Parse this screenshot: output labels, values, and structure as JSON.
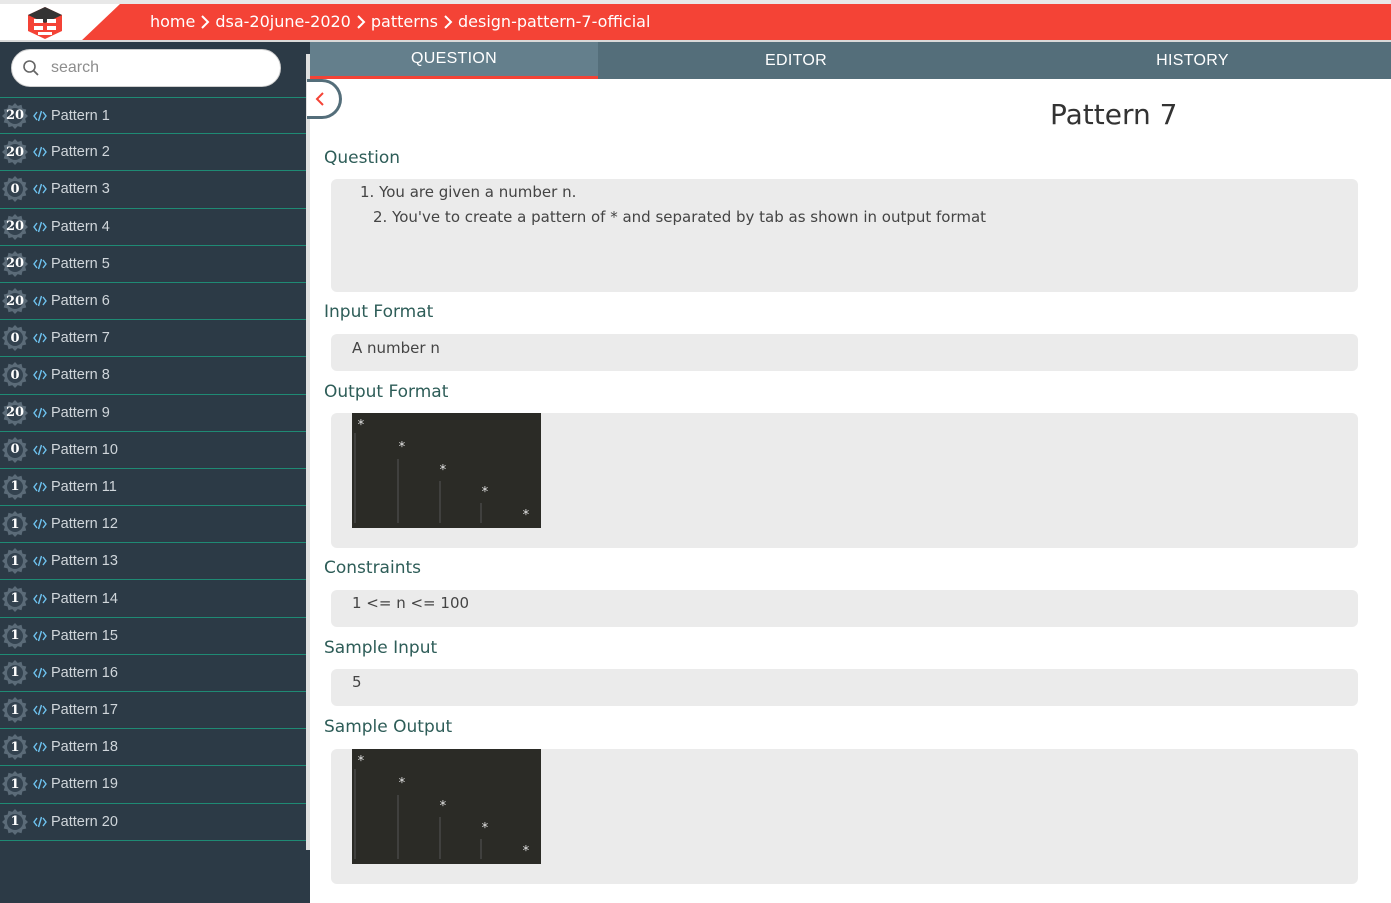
{
  "header": {
    "logo_icon": "pepcoding-logo-icon",
    "breadcrumb": [
      "home",
      "dsa-20june-2020",
      "patterns",
      "design-pattern-7-official"
    ]
  },
  "sidebar": {
    "search": {
      "placeholder": "search",
      "value": ""
    },
    "items": [
      {
        "score": "20",
        "label": "Pattern 1"
      },
      {
        "score": "20",
        "label": "Pattern 2"
      },
      {
        "score": "0",
        "label": "Pattern 3"
      },
      {
        "score": "20",
        "label": "Pattern 4"
      },
      {
        "score": "20",
        "label": "Pattern 5"
      },
      {
        "score": "20",
        "label": "Pattern 6"
      },
      {
        "score": "0",
        "label": "Pattern 7"
      },
      {
        "score": "0",
        "label": "Pattern 8"
      },
      {
        "score": "20",
        "label": "Pattern 9"
      },
      {
        "score": "0",
        "label": "Pattern 10"
      },
      {
        "score": "1",
        "label": "Pattern 11"
      },
      {
        "score": "1",
        "label": "Pattern 12"
      },
      {
        "score": "1",
        "label": "Pattern 13"
      },
      {
        "score": "1",
        "label": "Pattern 14"
      },
      {
        "score": "1",
        "label": "Pattern 15"
      },
      {
        "score": "1",
        "label": "Pattern 16"
      },
      {
        "score": "1",
        "label": "Pattern 17"
      },
      {
        "score": "1",
        "label": "Pattern 18"
      },
      {
        "score": "1",
        "label": "Pattern 19"
      },
      {
        "score": "1",
        "label": "Pattern 20"
      }
    ]
  },
  "tabs": [
    {
      "label": "QUESTION",
      "active": true
    },
    {
      "label": "EDITOR",
      "active": false
    },
    {
      "label": "HISTORY",
      "active": false
    }
  ],
  "main": {
    "title": "Pattern 7",
    "question_label": "Question",
    "question_lines": [
      "1. You are given a number n.",
      "2. You've to create a pattern of * and separated by tab as shown in output format"
    ],
    "input_format_label": "Input Format",
    "input_format": "A number n",
    "output_format_label": "Output Format",
    "constraints_label": "Constraints",
    "constraints": "1 <= n <= 100",
    "sample_input_label": "Sample Input",
    "sample_input": "5",
    "sample_output_label": "Sample Output"
  },
  "colors": {
    "accent": "#f44336",
    "tab_bar": "#546e7a",
    "sidebar_bg": "#2c3a46",
    "divider": "#1f8a74",
    "section_label": "#2e5d58"
  }
}
